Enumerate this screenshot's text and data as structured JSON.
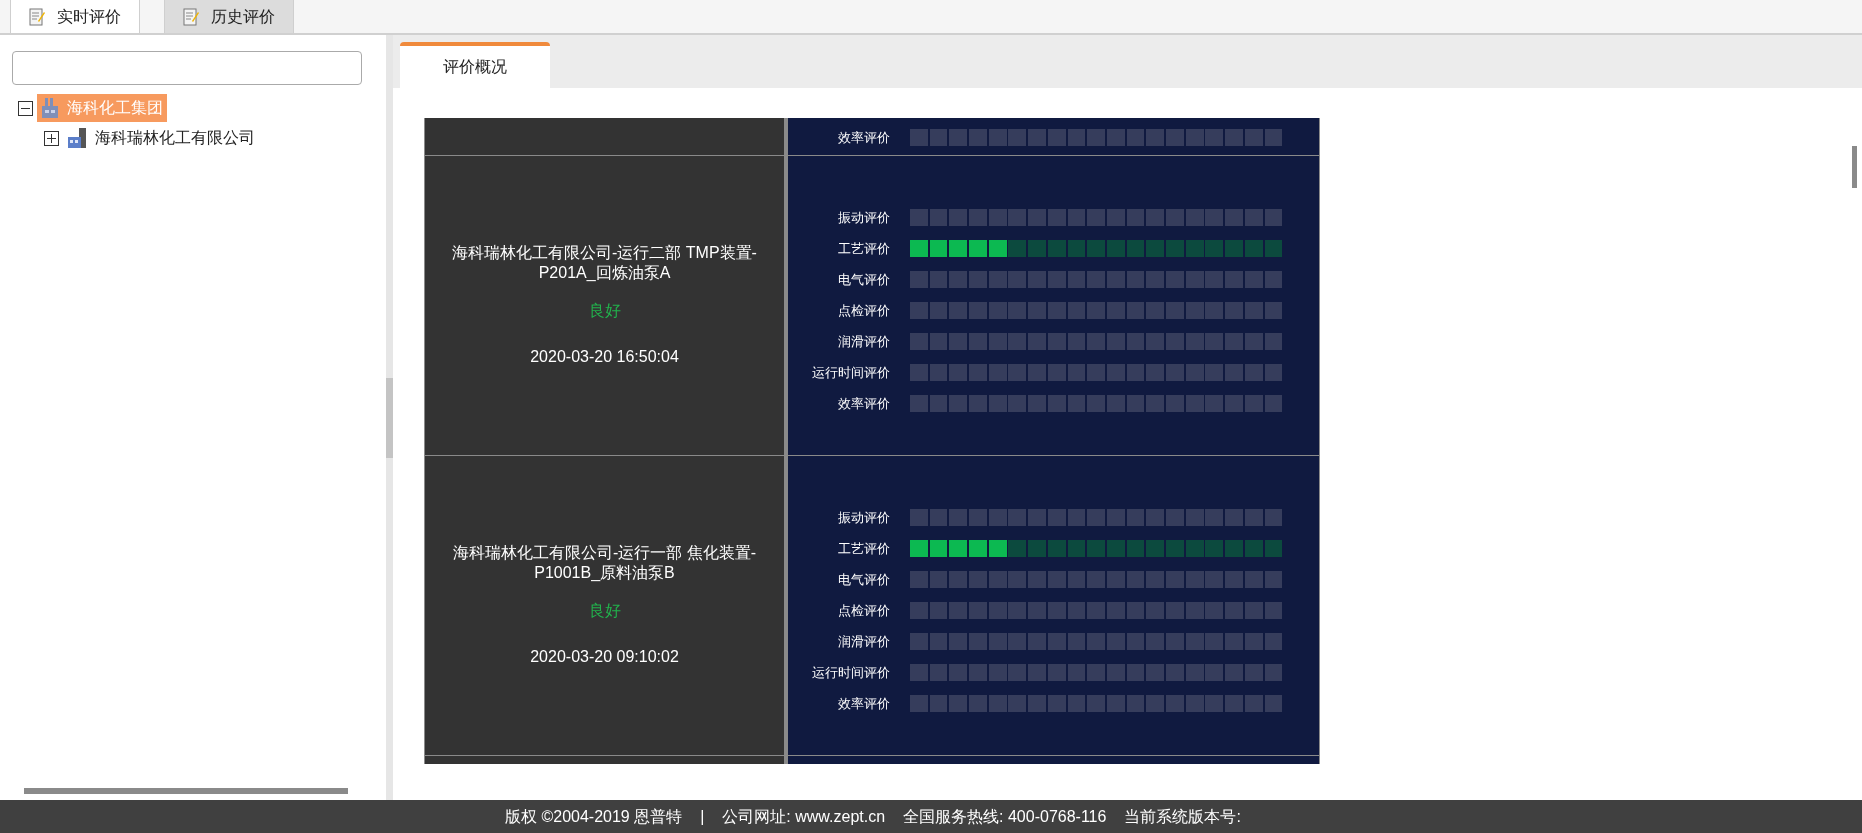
{
  "top_tabs": [
    {
      "label": "实时评价",
      "selected": true
    },
    {
      "label": "历史评价",
      "selected": false
    }
  ],
  "tree": [
    {
      "label": "海科化工集团",
      "selected": true,
      "expanded": true,
      "children": [
        {
          "label": "海科瑞林化工有限公司",
          "selected": false,
          "expanded": false
        }
      ]
    }
  ],
  "content_tabs": [
    {
      "label": "评价概况",
      "selected": true
    }
  ],
  "devices": [
    {
      "kind": "partial",
      "ratings": [
        {
          "label": "效率评价"
        }
      ]
    },
    {
      "kind": "full",
      "name": "海科瑞林化工有限公司-运行二部 TMP装置-P201A_回炼油泵A",
      "status": "良好",
      "time": "2020-03-20 16:50:04",
      "ratings": [
        {
          "label": "振动评价"
        },
        {
          "label": "工艺评价",
          "level": 0.263
        },
        {
          "label": "电气评价"
        },
        {
          "label": "点检评价"
        },
        {
          "label": "润滑评价"
        },
        {
          "label": "运行时间评价"
        },
        {
          "label": "效率评价"
        }
      ]
    },
    {
      "kind": "full",
      "name": "海科瑞林化工有限公司-运行一部 焦化装置-P1001B_原料油泵B",
      "status": "良好",
      "time": "2020-03-20 09:10:02",
      "ratings": [
        {
          "label": "振动评价"
        },
        {
          "label": "工艺评价",
          "level": 0.263
        },
        {
          "label": "电气评价"
        },
        {
          "label": "点检评价"
        },
        {
          "label": "润滑评价"
        },
        {
          "label": "运行时间评价"
        },
        {
          "label": "效率评价"
        }
      ]
    }
  ],
  "footer": [
    "版权 ©2004-2019 恩普特",
    "|",
    "公司网址: www.zept.cn",
    "全国服务热线: 400-0768-116",
    "当前系统版本号:"
  ]
}
